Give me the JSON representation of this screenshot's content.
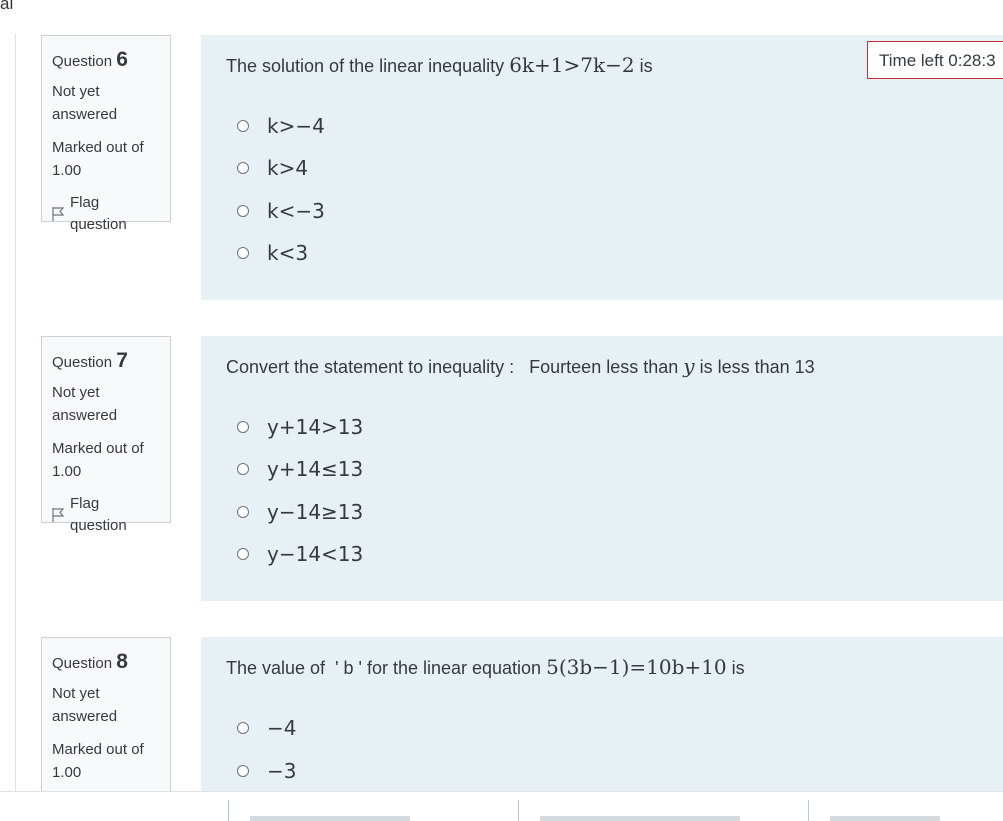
{
  "top_fragment": "al",
  "timer": {
    "text": "Time left 0:28:3"
  },
  "questions": [
    {
      "number_label": "Question",
      "number": "6",
      "state": "Not yet answered",
      "grade": "Marked out of 1.00",
      "flag_label": "Flag question",
      "text_before": "The solution of the linear inequality",
      "math": "6k+1>7k−2",
      "text_after": "is",
      "options": [
        "k>−4",
        "k>4",
        "k<−3",
        "k<3"
      ]
    },
    {
      "number_label": "Question",
      "number": "7",
      "state": "Not yet answered",
      "grade": "Marked out of 1.00",
      "flag_label": "Flag question",
      "text_before": "Convert the statement to inequality :   Fourteen less than",
      "math": "y",
      "text_after": "is less than 13",
      "options": [
        "y+14>13",
        "y+14≤13",
        "y−14≥13",
        "y−14<13"
      ]
    },
    {
      "number_label": "Question",
      "number": "8",
      "state": "Not yet answered",
      "grade": "Marked out of 1.00",
      "flag_label": "",
      "text_before": "The value of  ' b ' for the linear equation",
      "math": "5(3b−1)=10b+10",
      "text_after": "is",
      "options": [
        "−4",
        "−3"
      ]
    }
  ]
}
